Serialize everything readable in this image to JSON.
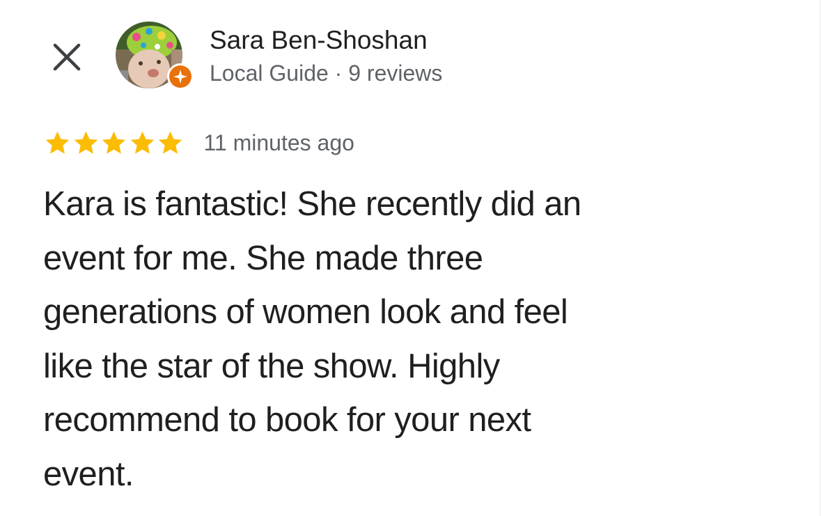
{
  "reviewer": {
    "name": "Sara Ben-Shoshan",
    "meta": "Local Guide · 9 reviews",
    "avatar_icon": "profile-photo",
    "badge_icon": "local-guide-star-icon"
  },
  "close": {
    "icon": "close-icon"
  },
  "rating": {
    "stars": 5,
    "max_stars": 5,
    "time_ago": "11 minutes ago"
  },
  "review": {
    "text": "Kara is fantastic! She recently did an\nevent for me. She made three\ngenerations of women look and feel\nlike the star of the show. Highly\nrecommend to book for your next\nevent."
  },
  "colors": {
    "star": "#fbbc04",
    "badge": "#e8710a",
    "secondary_text": "#5f6368",
    "primary_text": "#1f1f1f"
  }
}
